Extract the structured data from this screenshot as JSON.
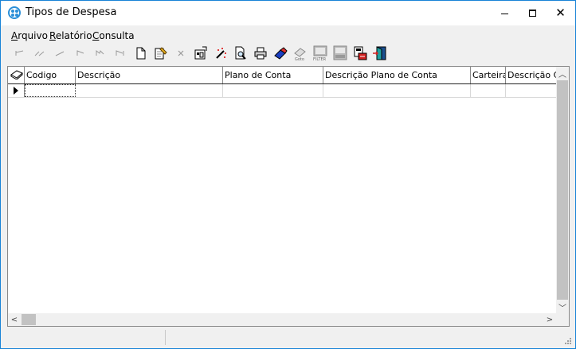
{
  "window": {
    "title": "Tipos de Despesa",
    "accent_color": "#1883d7"
  },
  "menu": [
    {
      "label": "Arquivo",
      "mnemonic": "A",
      "rest": "rquivo"
    },
    {
      "label": "Relatório",
      "mnemonic": "R",
      "rest": "elatório"
    },
    {
      "label": "Consulta",
      "mnemonic": "C",
      "rest": "onsulta"
    }
  ],
  "toolbar": {
    "buttons": [
      {
        "name": "first-record-icon",
        "enabled": false
      },
      {
        "name": "prev-page-icon",
        "enabled": false
      },
      {
        "name": "prev-record-icon",
        "enabled": false
      },
      {
        "name": "next-record-icon",
        "enabled": false
      },
      {
        "name": "next-page-icon",
        "enabled": false
      },
      {
        "name": "last-record-icon",
        "enabled": false
      },
      {
        "name": "new-document-icon",
        "enabled": true
      },
      {
        "name": "edit-document-icon",
        "enabled": true
      },
      {
        "name": "delete-icon",
        "enabled": false
      },
      {
        "name": "properties-icon",
        "enabled": true
      },
      {
        "name": "magic-wand-icon",
        "enabled": true
      },
      {
        "name": "print-preview-icon",
        "enabled": true
      },
      {
        "name": "print-icon",
        "enabled": true
      },
      {
        "name": "eraser-icon",
        "enabled": true
      },
      {
        "name": "goto-icon",
        "enabled": false,
        "caption": "Goto"
      },
      {
        "name": "filter-icon",
        "enabled": false,
        "caption": "FILTER"
      },
      {
        "name": "filter-list-icon",
        "enabled": false
      },
      {
        "name": "export-icon",
        "enabled": true
      },
      {
        "name": "exit-door-icon",
        "enabled": true
      }
    ]
  },
  "grid": {
    "columns": [
      {
        "label": "Codigo"
      },
      {
        "label": "Descrição"
      },
      {
        "label": "Plano de Conta"
      },
      {
        "label": "Descrição Plano de Conta"
      },
      {
        "label": "Carteira"
      },
      {
        "label": "Descrição Ca"
      }
    ],
    "rows": [
      {
        "cells": [
          "",
          "",
          "",
          "",
          "",
          ""
        ]
      }
    ]
  },
  "statusbar": {
    "panels": [
      "",
      ""
    ]
  }
}
